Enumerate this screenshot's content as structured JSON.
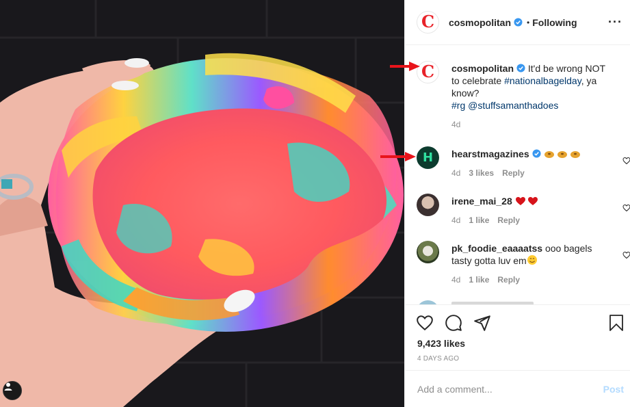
{
  "post": {
    "author": "cosmopolitan",
    "follow_status": "Following",
    "dot": "•",
    "more_icon": "more-horizontal-icon",
    "likes": "9,423 likes",
    "age": "4 DAYS AGO"
  },
  "caption": {
    "username": "cosmopolitan",
    "text": "It'd be wrong NOT to celebrate",
    "hashtag1": "#nationalbagelday",
    "text2": ", ya know?",
    "hashtag2": "#rg",
    "mention": "@stuffsamanthadoes",
    "time": "4d"
  },
  "comments": [
    {
      "username": "hearstmagazines",
      "text": "",
      "emoji": "bagel bagel bagel",
      "time": "4d",
      "likes": "3 likes",
      "reply": "Reply"
    },
    {
      "username": "irene_mai_28",
      "text": "",
      "emoji": "heart heart",
      "time": "4d",
      "likes": "1 like",
      "reply": "Reply"
    },
    {
      "username": "pk_foodie_eaaaatss",
      "text": "ooo bagels tasty gotta luv em",
      "emoji": "smile",
      "time": "4d",
      "likes": "1 like",
      "reply": "Reply"
    }
  ],
  "add_comment": {
    "placeholder": "Add a comment...",
    "post_label": "Post"
  },
  "colors": {
    "brand_red": "#e8232a",
    "link": "#00376b",
    "verified": "#3897f0",
    "post_button": "#b3dbff",
    "arrow": "#e8141b"
  }
}
